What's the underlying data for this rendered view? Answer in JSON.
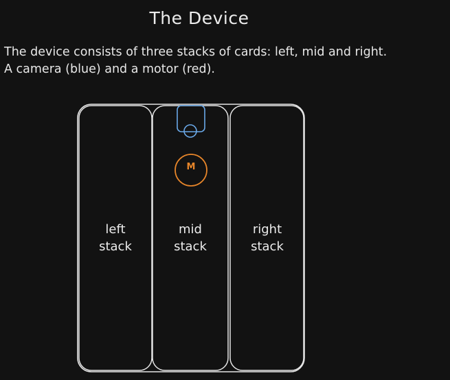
{
  "title": "The Device",
  "description": {
    "line1": "The device consists of three stacks of cards: left, mid and right.",
    "line2": "A camera (blue) and a motor (red)."
  },
  "stacks": [
    {
      "line1": "left",
      "line2": "stack"
    },
    {
      "line1": "mid",
      "line2": "stack"
    },
    {
      "line1": "right",
      "line2": "stack"
    }
  ],
  "motor": {
    "label": "M",
    "color": "#e8862a"
  },
  "camera": {
    "color": "#6aa9e9"
  },
  "outline_color": "#e6e6e6"
}
